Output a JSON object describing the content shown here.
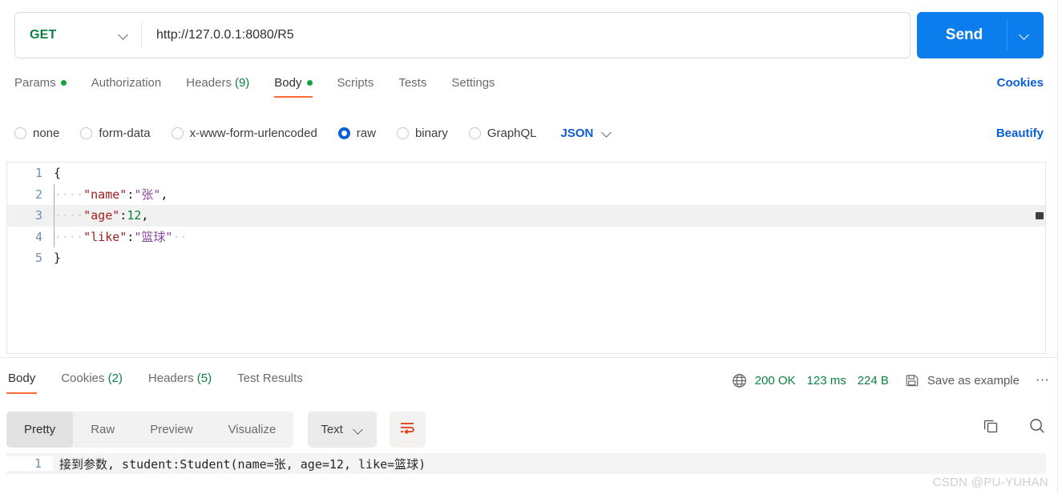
{
  "request": {
    "method": "GET",
    "url": "http://127.0.0.1:8080/R5",
    "send_label": "Send",
    "method_chevron_icon": "chevron-down-icon",
    "send_chevron_icon": "chevron-down-icon",
    "tabs": [
      {
        "label": "Params",
        "dot": true,
        "active": false
      },
      {
        "label": "Authorization",
        "dot": false,
        "active": false
      },
      {
        "label": "Headers",
        "count": "(9)",
        "dot": false,
        "active": false
      },
      {
        "label": "Body",
        "dot": true,
        "active": true
      },
      {
        "label": "Scripts",
        "dot": false,
        "active": false
      },
      {
        "label": "Tests",
        "dot": false,
        "active": false
      },
      {
        "label": "Settings",
        "dot": false,
        "active": false
      }
    ],
    "cookies_link": "Cookies",
    "body_types": [
      {
        "label": "none",
        "selected": false
      },
      {
        "label": "form-data",
        "selected": false
      },
      {
        "label": "x-www-form-urlencoded",
        "selected": false
      },
      {
        "label": "raw",
        "selected": true
      },
      {
        "label": "binary",
        "selected": false
      },
      {
        "label": "GraphQL",
        "selected": false
      }
    ],
    "raw_format": "JSON",
    "beautify_label": "Beautify",
    "editor": {
      "lines": [
        {
          "n": "1",
          "highlight": false,
          "indent": false,
          "tokens": [
            {
              "t": "{",
              "c": "k-brace"
            }
          ]
        },
        {
          "n": "2",
          "highlight": false,
          "indent": true,
          "tokens": [
            {
              "t": "····",
              "c": "ws"
            },
            {
              "t": "\"name\"",
              "c": "k-key"
            },
            {
              "t": ":",
              "c": "k-punc"
            },
            {
              "t": "\"张\"",
              "c": "k-str"
            },
            {
              "t": ",",
              "c": "k-punc"
            }
          ]
        },
        {
          "n": "3",
          "highlight": true,
          "indent": true,
          "tokens": [
            {
              "t": "····",
              "c": "ws"
            },
            {
              "t": "\"age\"",
              "c": "k-key"
            },
            {
              "t": ":",
              "c": "k-punc"
            },
            {
              "t": "12",
              "c": "k-num"
            },
            {
              "t": ",",
              "c": "k-punc"
            }
          ]
        },
        {
          "n": "4",
          "highlight": false,
          "indent": true,
          "tokens": [
            {
              "t": "····",
              "c": "ws"
            },
            {
              "t": "\"like\"",
              "c": "k-key"
            },
            {
              "t": ":",
              "c": "k-punc"
            },
            {
              "t": "\"篮球\"",
              "c": "k-str"
            },
            {
              "t": "··",
              "c": "ws"
            }
          ]
        },
        {
          "n": "5",
          "highlight": false,
          "indent": false,
          "tokens": [
            {
              "t": "}",
              "c": "k-brace"
            }
          ]
        }
      ]
    }
  },
  "response": {
    "tabs": [
      {
        "label": "Body",
        "count": "",
        "active": true
      },
      {
        "label": "Cookies",
        "count": " (2)",
        "active": false
      },
      {
        "label": "Headers",
        "count": " (5)",
        "active": false
      },
      {
        "label": "Test Results",
        "count": "",
        "active": false
      }
    ],
    "globe_icon": "globe-icon",
    "status": "200 OK",
    "time": "123 ms",
    "size": "224 B",
    "save_icon": "save-icon",
    "save_as_example": "Save as example",
    "more_menu": "⋯",
    "view_modes": [
      {
        "label": "Pretty",
        "active": true
      },
      {
        "label": "Raw",
        "active": false
      },
      {
        "label": "Preview",
        "active": false
      },
      {
        "label": "Visualize",
        "active": false
      }
    ],
    "format": "Text",
    "format_chevron_icon": "chevron-down-icon",
    "wrap_icon": "word-wrap-icon",
    "copy_icon": "copy-icon",
    "search_icon": "search-icon",
    "body_lines": [
      {
        "n": "1",
        "text": "接到参数, student:Student(name=张, age=12, like=篮球)"
      }
    ]
  },
  "watermark": "CSDN @PU-YUHAN",
  "colors": {
    "accent_orange": "#ff6c37",
    "link_blue": "#0b5ed7",
    "send_blue": "#0b7dec",
    "green": "#0b8043",
    "method_green": "#0b8043"
  }
}
